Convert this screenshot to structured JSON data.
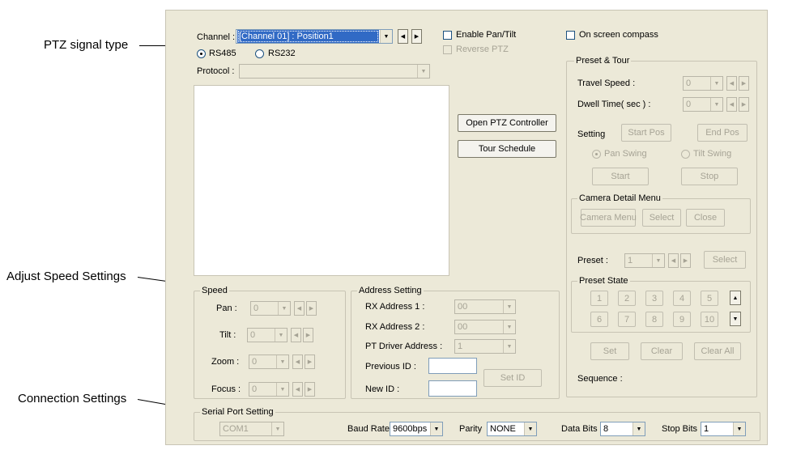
{
  "callouts": {
    "ptz_signal_type": "PTZ signal type",
    "adjust_speed": "Adjust Speed Settings",
    "connection": "Connection Settings"
  },
  "channel": {
    "label": "Channel :",
    "value": "[Channel 01] : Position1"
  },
  "signal": {
    "rs485": "RS485",
    "rs232": "RS232",
    "selected": "RS485"
  },
  "protocol": {
    "label": "Protocol :",
    "value": ""
  },
  "checks": {
    "enable_pan_tilt": "Enable Pan/Tilt",
    "reverse_ptz": "Reverse PTZ",
    "on_screen_compass": "On screen compass"
  },
  "buttons": {
    "open_ptz_controller": "Open PTZ Controller",
    "tour_schedule": "Tour Schedule"
  },
  "preset_tour": {
    "title": "Preset & Tour",
    "travel_speed_label": "Travel Speed :",
    "travel_speed_value": "0",
    "dwell_time_label": "Dwell Time( sec ) :",
    "dwell_time_value": "0",
    "setting_label": "Setting",
    "start_pos": "Start Pos",
    "end_pos": "End Pos",
    "pan_swing": "Pan Swing",
    "tilt_swing": "Tilt Swing",
    "start": "Start",
    "stop": "Stop",
    "camera_detail_title": "Camera Detail Menu",
    "camera_menu": "Camera Menu",
    "select": "Select",
    "close": "Close",
    "preset_label": "Preset :",
    "preset_value": "1",
    "preset_select": "Select",
    "preset_state_title": "Preset State",
    "preset_numbers": [
      "1",
      "2",
      "3",
      "4",
      "5",
      "6",
      "7",
      "8",
      "9",
      "10"
    ],
    "set": "Set",
    "clear": "Clear",
    "clear_all": "Clear All",
    "sequence_label": "Sequence :"
  },
  "speed": {
    "title": "Speed",
    "pan_label": "Pan :",
    "tilt_label": "Tilt :",
    "zoom_label": "Zoom :",
    "focus_label": "Focus :",
    "pan_value": "0",
    "tilt_value": "0",
    "zoom_value": "0",
    "focus_value": "0"
  },
  "address": {
    "title": "Address Setting",
    "rx1_label": "RX Address 1 :",
    "rx1_value": "00",
    "rx2_label": "RX Address 2 :",
    "rx2_value": "00",
    "pt_driver_label": "PT Driver Address :",
    "pt_driver_value": "1",
    "previous_id_label": "Previous ID :",
    "new_id_label": "New ID :",
    "set_id": "Set ID"
  },
  "serial": {
    "title": "Serial Port Setting",
    "port_value": "COM1",
    "baud_label": "Baud Rate",
    "baud_value": "9600bps",
    "parity_label": "Parity",
    "parity_value": "NONE",
    "data_bits_label": "Data Bits",
    "data_bits_value": "8",
    "stop_bits_label": "Stop Bits",
    "stop_bits_value": "1"
  }
}
